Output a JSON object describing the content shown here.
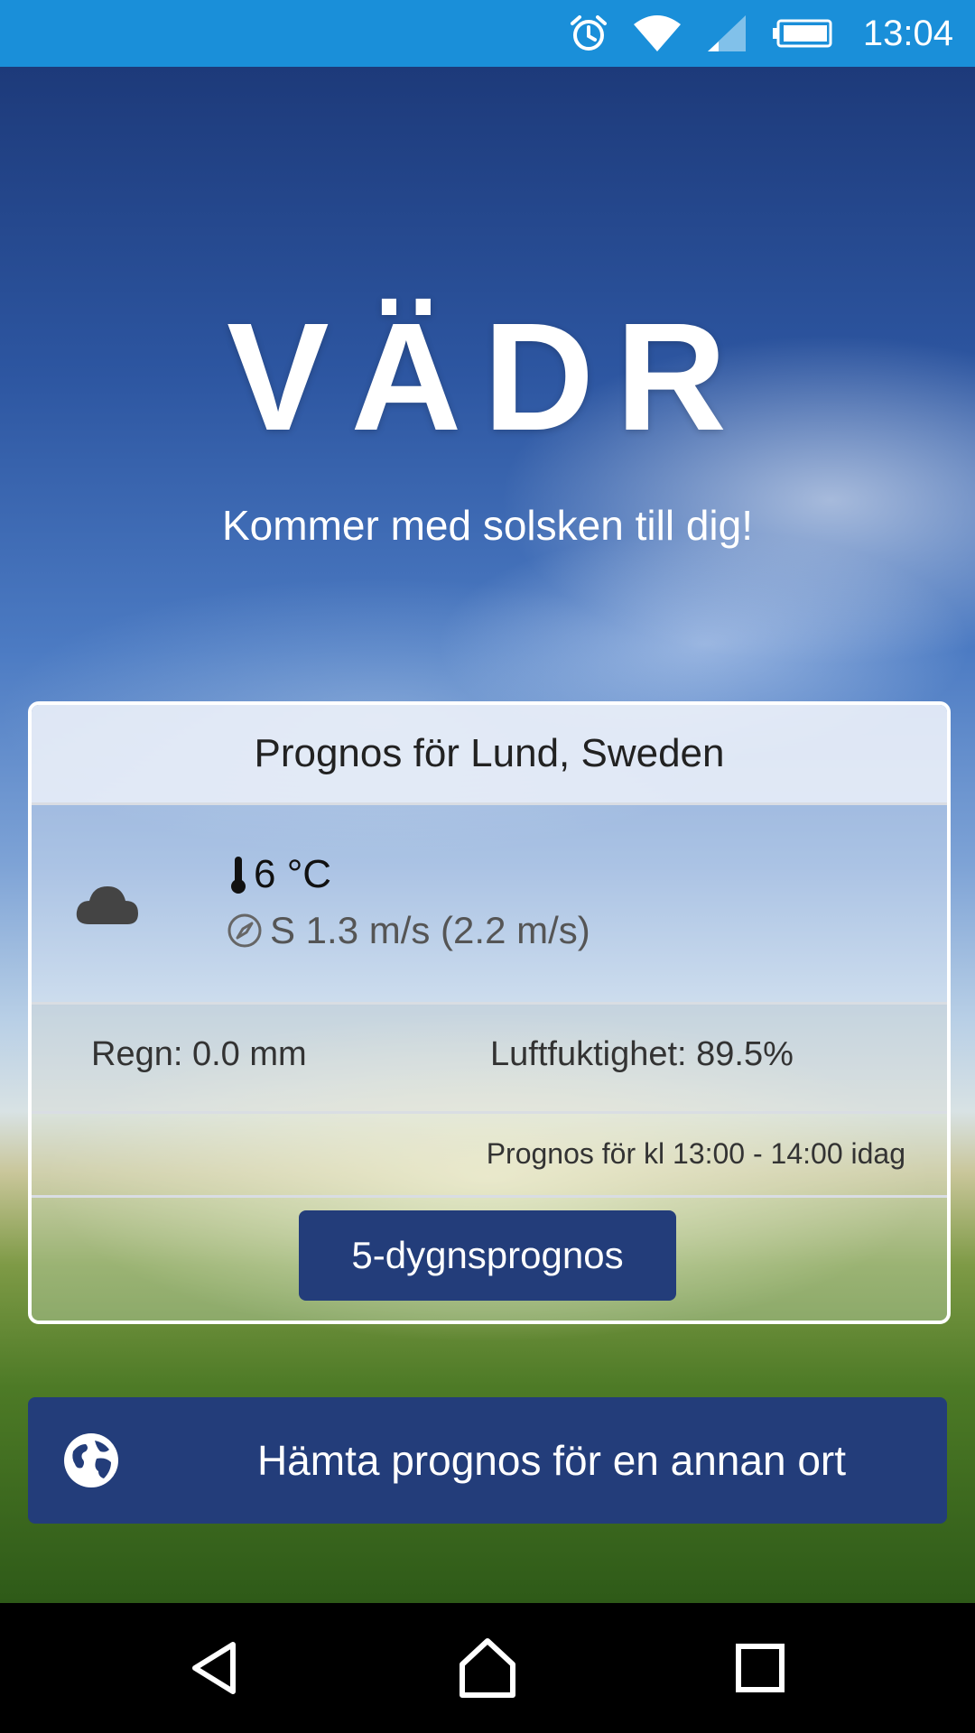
{
  "status_bar": {
    "time": "13:04",
    "icons": [
      "alarm-icon",
      "wifi-icon",
      "signal-icon",
      "battery-icon"
    ]
  },
  "hero": {
    "title": "VÄDR",
    "tagline": "Kommer med solsken till dig!"
  },
  "forecast": {
    "header": "Prognos för Lund, Sweden",
    "weather_icon": "cloud-icon",
    "temperature": "6 °C",
    "wind": "S 1.3 m/s (2.2 m/s)",
    "rain": "Regn: 0.0 mm",
    "humidity": "Luftfuktighet: 89.5%",
    "period": "Prognos för kl 13:00 - 14:00 idag",
    "five_day_label": "5-dygnsprognos"
  },
  "other_location": {
    "label": "Hämta prognos för en annan ort",
    "icon": "globe-icon"
  },
  "nav": {
    "items": [
      "back-icon",
      "home-icon",
      "recents-icon"
    ]
  },
  "colors": {
    "status_bar": "#1a8fd9",
    "button": "#233d7a"
  }
}
